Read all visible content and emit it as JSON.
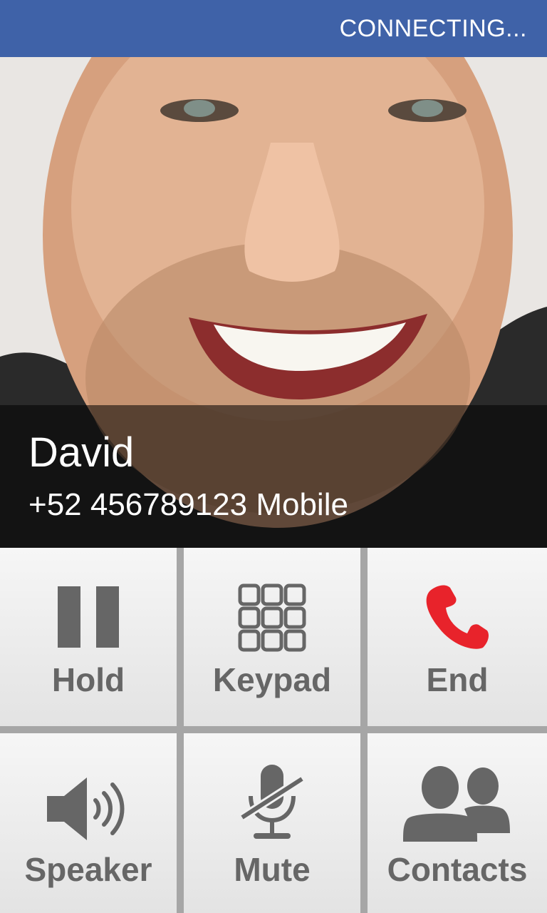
{
  "status": {
    "text": "CONNECTING..."
  },
  "caller": {
    "name": "David",
    "number": "+52 456789123 Mobile"
  },
  "actions": [
    {
      "label": "Hold",
      "icon": "pause-icon"
    },
    {
      "label": "Keypad",
      "icon": "keypad-icon"
    },
    {
      "label": "End",
      "icon": "end-call-icon"
    },
    {
      "label": "Speaker",
      "icon": "speaker-icon"
    },
    {
      "label": "Mute",
      "icon": "mic-muted-icon"
    },
    {
      "label": "Contacts",
      "icon": "contacts-icon"
    }
  ],
  "colors": {
    "status_bar": "#3f62a8",
    "end_call": "#e8232b",
    "icon_gray": "#666666"
  }
}
